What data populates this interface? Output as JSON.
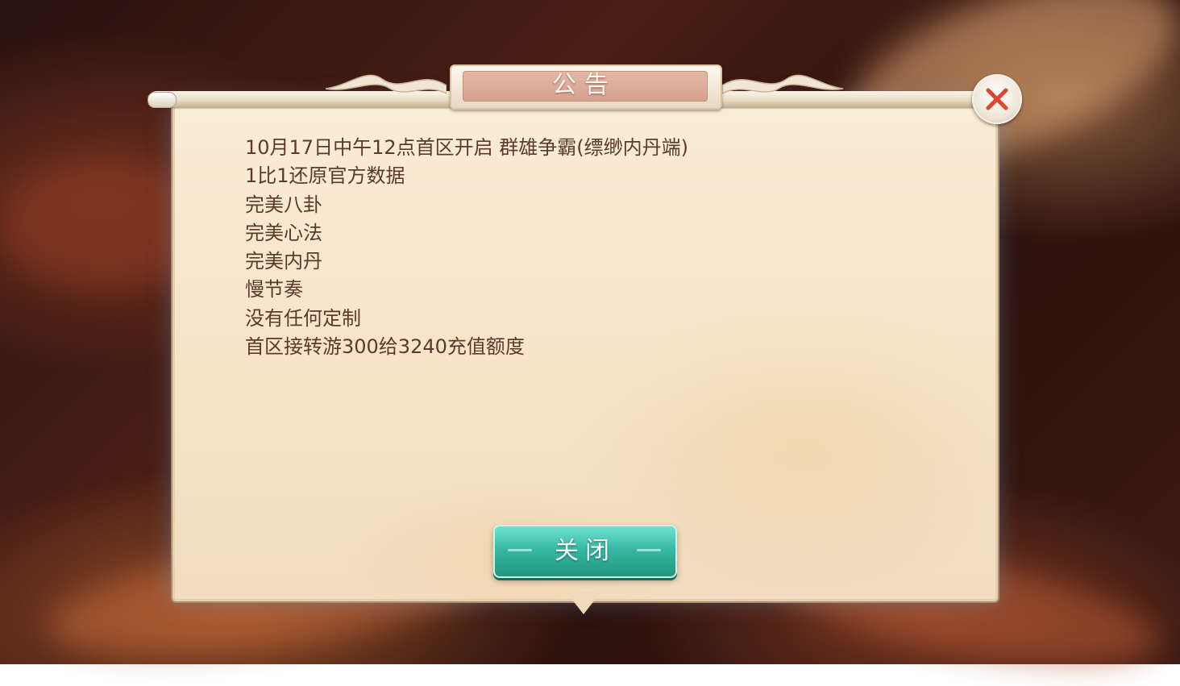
{
  "dialog": {
    "title": "公告",
    "lines": [
      "10月17日中午12点首区开启 群雄争霸(缥缈内丹端)",
      "1比1还原官方数据",
      "完美八卦",
      "完美心法",
      "完美内丹",
      "慢节奏",
      "没有任何定制",
      "首区接转游300给3240充值额度"
    ],
    "close_button_label": "关闭",
    "close_icon": "close-x-icon"
  },
  "colors": {
    "parchment": "#f7e4c9",
    "text": "#5a3a2c",
    "button_teal": "#37b9a4",
    "close_red": "#e0452f"
  }
}
